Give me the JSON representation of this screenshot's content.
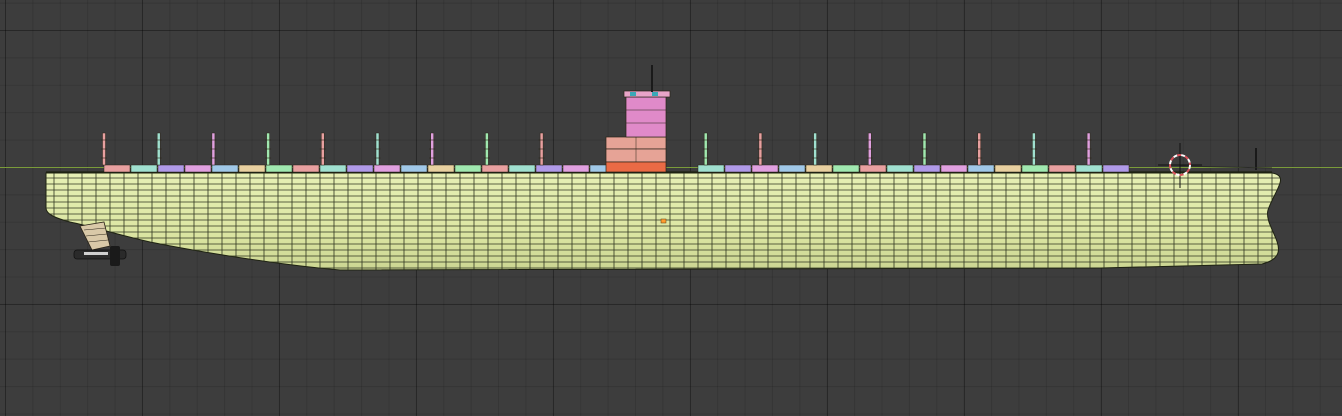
{
  "viewport": {
    "background_color": "#3d3d3d",
    "grid_color": "#2f2f2f",
    "horizon_color": "#7a9b3a"
  },
  "model": {
    "object": "container-ship-hull-mesh",
    "hull_color": "#dfe9a8",
    "hull_edge_color": "#1e2212",
    "rudder_color": "#d9c9a8",
    "bridge_colors": [
      "#e08ac9",
      "#e6a396",
      "#ea6a45"
    ],
    "container_colors": [
      "#e8a0a0",
      "#a0e0d0",
      "#b09ae8",
      "#e0a0e0",
      "#a0c8e8",
      "#e8d0a0",
      "#a0e8b0"
    ],
    "origin_marker_color": "#ff9b2e",
    "cursor_3d_colors": [
      "#d8505a",
      "#ffffff"
    ]
  }
}
